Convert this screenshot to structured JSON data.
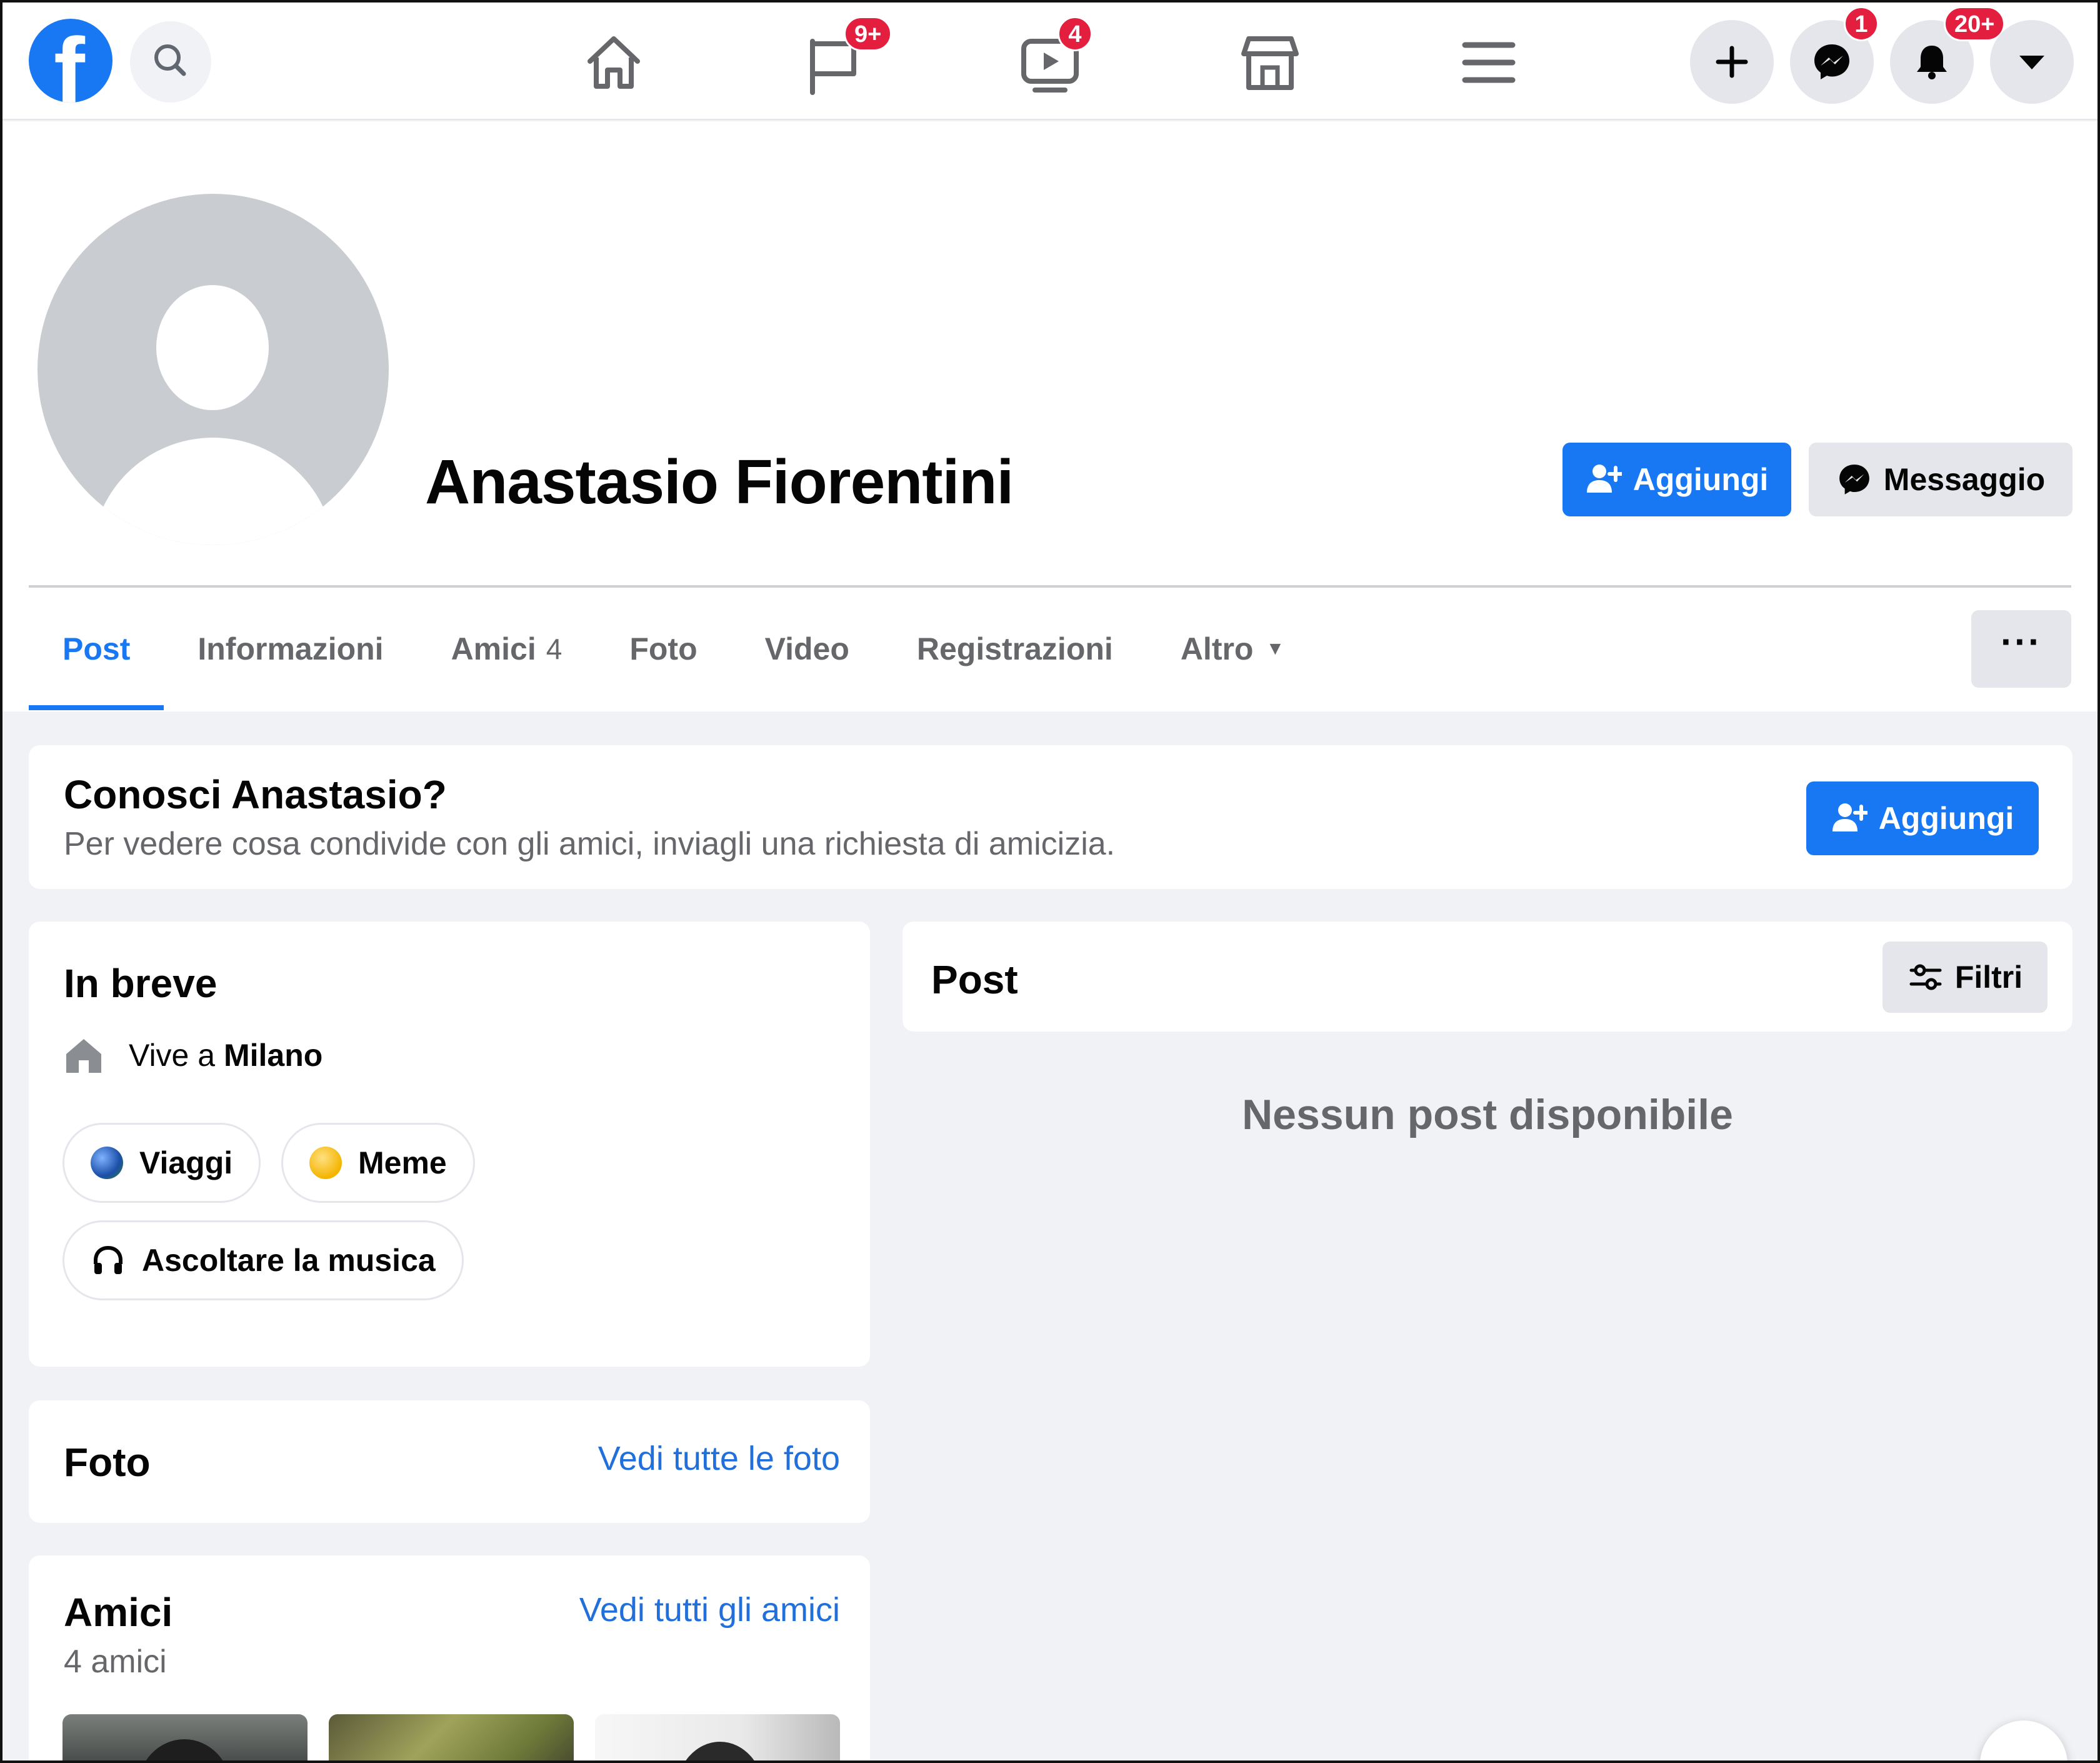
{
  "nav": {
    "badges": {
      "flag": "9+",
      "video": "4",
      "messenger": "1",
      "notifications": "20+"
    }
  },
  "profile": {
    "name": "Anastasio Fiorentini",
    "add_button": "Aggiungi",
    "message_button": "Messaggio"
  },
  "tabs": [
    {
      "label": "Post",
      "active": true
    },
    {
      "label": "Informazioni"
    },
    {
      "label": "Amici",
      "count": "4"
    },
    {
      "label": "Foto"
    },
    {
      "label": "Video"
    },
    {
      "label": "Registrazioni"
    },
    {
      "label": "Altro"
    }
  ],
  "more_button": "···",
  "know_card": {
    "title": "Conosci Anastasio?",
    "subtitle": "Per vedere cosa condivide con gli amici, inviagli una richiesta di amicizia.",
    "button": "Aggiungi"
  },
  "intro": {
    "title": "In breve",
    "lives_prefix": "Vive a",
    "city": "Milano",
    "hobbies": [
      "Viaggi",
      "Meme",
      "Ascoltare la musica"
    ]
  },
  "photos": {
    "title": "Foto",
    "link": "Vedi tutte le foto"
  },
  "friends": {
    "title": "Amici",
    "link": "Vedi tutti gli amici",
    "count_text": "4 amici"
  },
  "posts": {
    "title": "Post",
    "filter_button": "Filtri",
    "empty": "Nessun post disponibile"
  },
  "colors": {
    "brand": "#1877f2",
    "badge": "#e41e3f",
    "background": "#f0f2f5",
    "muted": "#65676b"
  }
}
